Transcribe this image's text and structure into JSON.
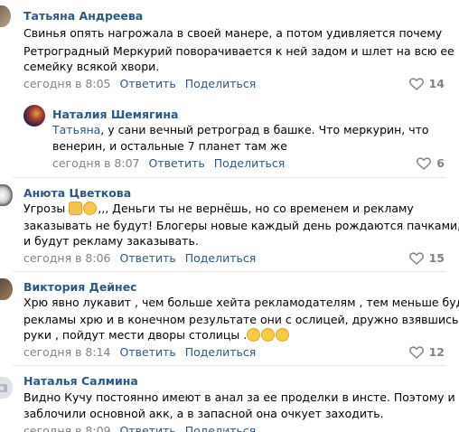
{
  "colors": {
    "link": "#2a5885",
    "meta": "#828282",
    "separator": "#e7e8ec"
  },
  "comments": [
    {
      "name": "Татьяна Андреева",
      "lines": [
        "Свинья опять нагрожала в своей манере, а потом удивляется почему",
        "Ретроградный Меркурий поворачивается к ней задом и шлет на всю ее",
        "семейку всякой хвори."
      ],
      "time": "сегодня в 8:05",
      "reply": "Ответить",
      "share": "Поделиться",
      "likes": "14"
    },
    {
      "name": "Наталия Шемягина",
      "mention": "Татьяна",
      "lines": [
        ", у сани вечный ретроград в башке. Что меркурин, что",
        "венерин, и остальные 7 планет там же"
      ],
      "time": "сегодня в 8:07",
      "reply": "Ответить",
      "share": "Поделиться",
      "likes": "6"
    },
    {
      "name": "Анюта Цветкова",
      "line1_prefix": "Угрозы",
      "line1_suffix": ",,, Деньги ты не вернёшь, но со временем и рекламу",
      "lines": [
        "заказывать не будут! Блогеры новые каждый день рождаются пачками, им",
        "и будут рекламу заказывать."
      ],
      "time": "сегодня в 8:06",
      "reply": "Ответить",
      "share": "Поделиться",
      "likes": "15"
    },
    {
      "name": "Виктория Дейнес",
      "lines": [
        "Хрю явно лукавит , чем больше хейта рекламодателям , тем меньше будет",
        "рекламы хрю и в конечном результате они с ослицей, дружно взявшись за",
        "руки , пойдут мести дворы столицы ."
      ],
      "time": "сегодня в 8:14",
      "reply": "Ответить",
      "share": "Поделиться",
      "likes": "12"
    },
    {
      "name": "Наталья Салмина",
      "lines": [
        "Видно Кучу постоянно имеют в анал за ее проделки в инсте. Поэтому и",
        "заблочили основной акк, а в запасной она очкует заходить."
      ],
      "time": "сегодня в 8:09",
      "reply": "Ответить",
      "share": "Поделиться",
      "likes": ""
    }
  ]
}
